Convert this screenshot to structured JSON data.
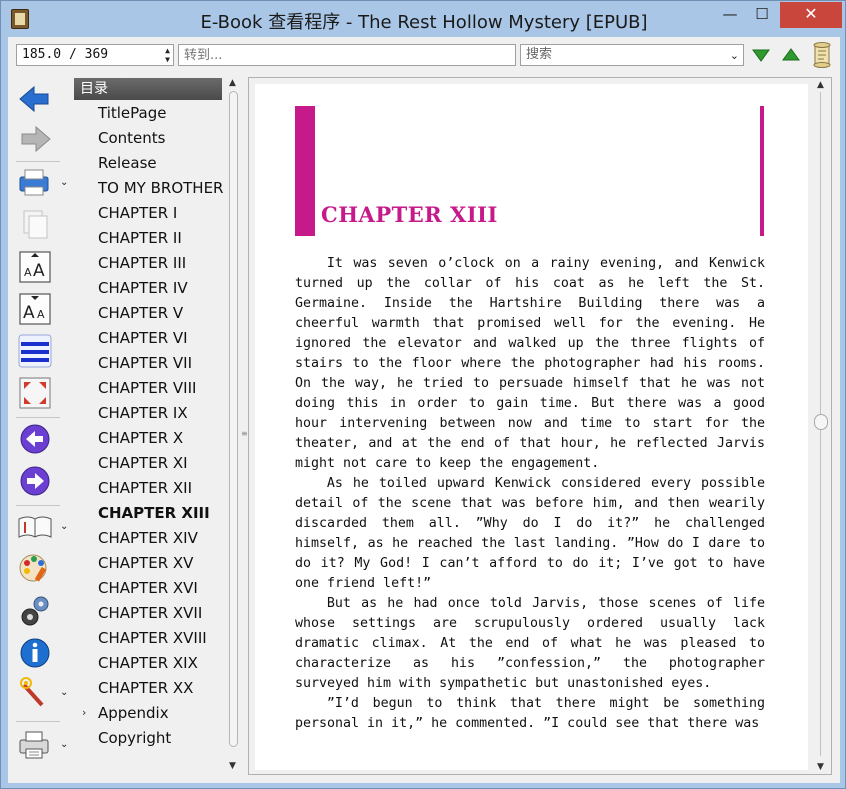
{
  "window": {
    "title": "E-Book 查看程序 - The Rest Hollow Mystery [EPUB]",
    "controls": {
      "minimize": "—",
      "maximize": "☐",
      "close": "✕"
    }
  },
  "toolbar": {
    "page_position": "185.0 / 369",
    "goto_placeholder": "转到...",
    "search_placeholder": "搜索",
    "icons": [
      "search-next-down-icon",
      "search-prev-up-icon",
      "scroll-icon"
    ]
  },
  "sidebar_icons": [
    "back-arrow-icon",
    "forward-arrow-icon",
    "print-preview-icon",
    "copy-page-icon",
    "font-larger-icon",
    "font-smaller-icon",
    "line-spacing-icon",
    "fullscreen-icon",
    "previous-chapter-icon",
    "next-chapter-icon",
    "book-icon",
    "theme-palette-icon",
    "settings-gear-icon",
    "info-icon",
    "magic-wand-icon",
    "printer-icon"
  ],
  "toc": {
    "header": "目录",
    "items": [
      "TitlePage",
      "Contents",
      "Release",
      "TO MY BROTHER",
      "CHAPTER I",
      "CHAPTER II",
      "CHAPTER III",
      "CHAPTER IV",
      "CHAPTER V",
      "CHAPTER VI",
      "CHAPTER VII",
      "CHAPTER VIII",
      "CHAPTER IX",
      "CHAPTER X",
      "CHAPTER XI",
      "CHAPTER XII",
      "CHAPTER XIII",
      "CHAPTER XIV",
      "CHAPTER XV",
      "CHAPTER XVI",
      "CHAPTER XVII",
      "CHAPTER XVIII",
      "CHAPTER XIX",
      "CHAPTER XX",
      "Appendix",
      "Copyright"
    ],
    "active": "CHAPTER XIII"
  },
  "page": {
    "chapter_title": "CHAPTER XIII",
    "paragraphs": [
      "It was seven o’clock on a rainy evening, and Kenwick turned up the collar of his coat as he left the St. Germaine. Inside the Hartshire Building there was a cheerful warmth that promised well for the evening. He ignored the elevator and walked up the three flights of stairs to the floor where the photographer had his rooms. On the way, he tried to persuade himself that he was not doing this in order to gain time. But there was a good hour intervening between now and time to start for the theater, and at the end of that hour, he reflected Jarvis might not care to keep the engagement.",
      "As he toiled upward Kenwick considered every possible detail of the scene that was before him, and then wearily discarded them all. ”Why do I do it?” he challenged himself, as he reached the last landing. ”How do I dare to do it? My God! I can’t afford to do it; I’ve got to have one friend left!”",
      "But as he had once told Jarvis, those scenes of life whose settings are scrupulously ordered usually lack dramatic climax. At the end of what he was pleased to characterize as his ”confession,” the photographer surveyed him with sympathetic but unastonished eyes.",
      "”I’d begun to think that there might be something personal in it,” he commented. ”I could see that there was"
    ]
  },
  "colors": {
    "accent": "#c6198a",
    "frame": "#a9c6e6",
    "close": "#c9463d"
  }
}
